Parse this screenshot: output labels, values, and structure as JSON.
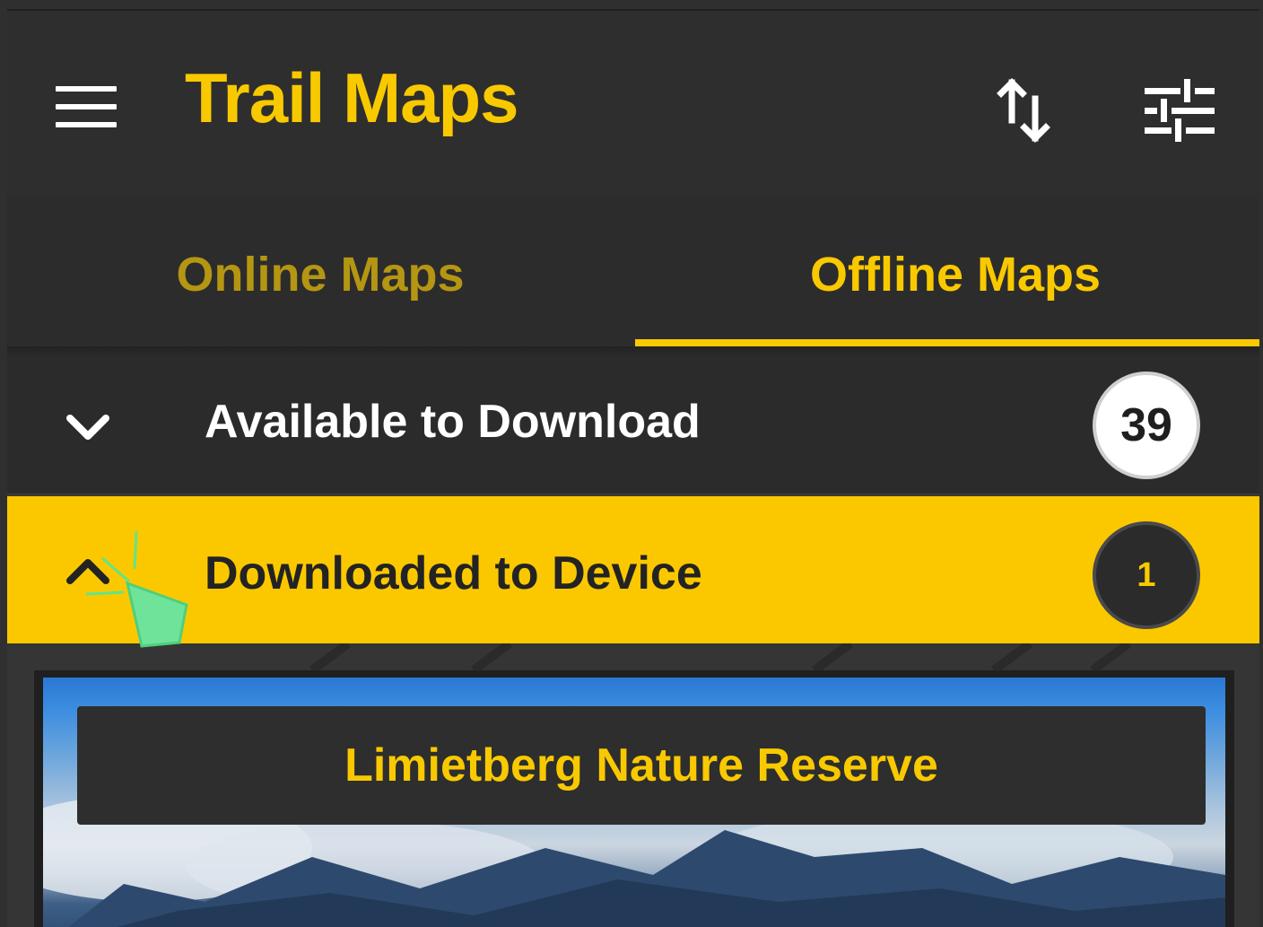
{
  "app": {
    "title": "Trail Maps",
    "accent_color": "#f9c900",
    "header": {
      "menu_icon": "hamburger-menu-icon",
      "sort_icon": "sort-arrows-icon",
      "filter_icon": "sliders-icon"
    }
  },
  "tabs": [
    {
      "label": "Online Maps",
      "selected": false
    },
    {
      "label": "Offline Maps",
      "selected": true
    }
  ],
  "sections": [
    {
      "label": "Available to Download",
      "count": "39",
      "expanded": false,
      "icon": "chevron-down-icon"
    },
    {
      "label": "Downloaded to Device",
      "count": "1",
      "expanded": true,
      "icon": "chevron-up-icon"
    }
  ],
  "map_card": {
    "title": "Limietberg Nature Reserve"
  }
}
